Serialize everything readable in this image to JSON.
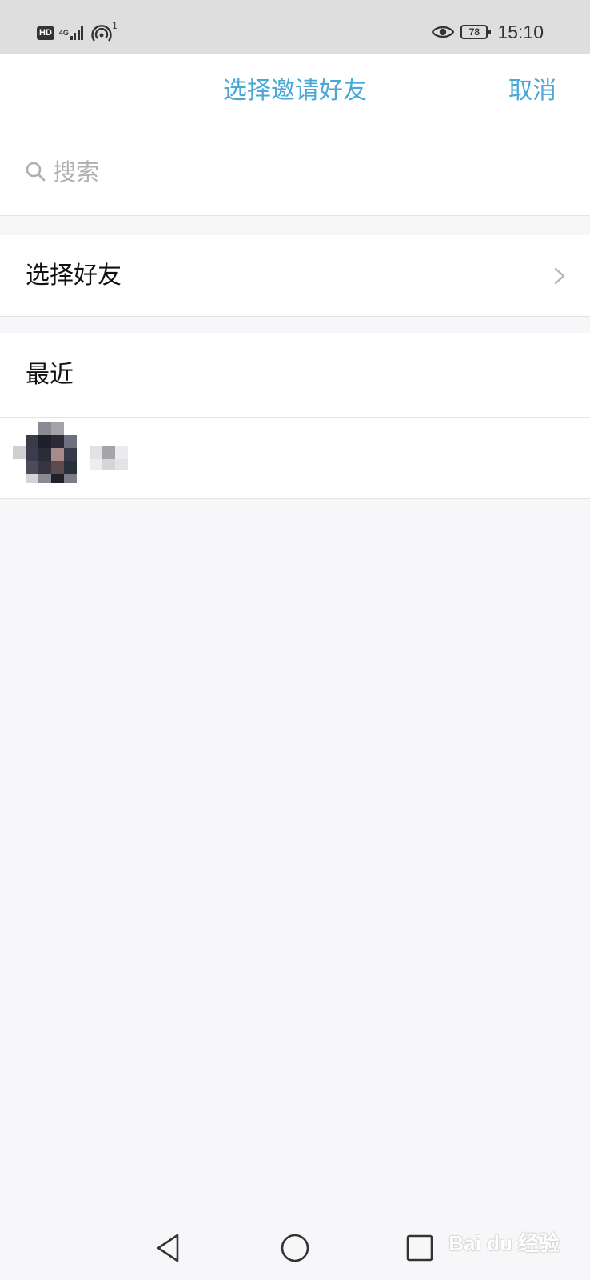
{
  "status_bar": {
    "hd_badge": "HD",
    "network_type": "4G",
    "hotspot_count": "1",
    "battery_level": "78",
    "time": "15:10",
    "icons": [
      "hd-icon",
      "signal-icon",
      "hotspot-icon",
      "eye-icon",
      "battery-icon"
    ]
  },
  "header": {
    "title": "选择邀请好友",
    "cancel_label": "取消"
  },
  "search": {
    "placeholder": "搜索",
    "value": ""
  },
  "select_friends": {
    "label": "选择好友"
  },
  "recent": {
    "label": "最近",
    "contacts": [
      {
        "avatar": "pixelated-avatar"
      }
    ]
  },
  "system_nav": {
    "buttons": [
      "back-triangle-icon",
      "home-circle-icon",
      "recents-square-icon"
    ]
  },
  "watermark": {
    "text": "Bai du 经验"
  },
  "colors": {
    "accent": "#4aa7d6",
    "page_background": "#f7f7f9",
    "status_bar_background": "#dedede",
    "divider": "#e3e3e3"
  }
}
